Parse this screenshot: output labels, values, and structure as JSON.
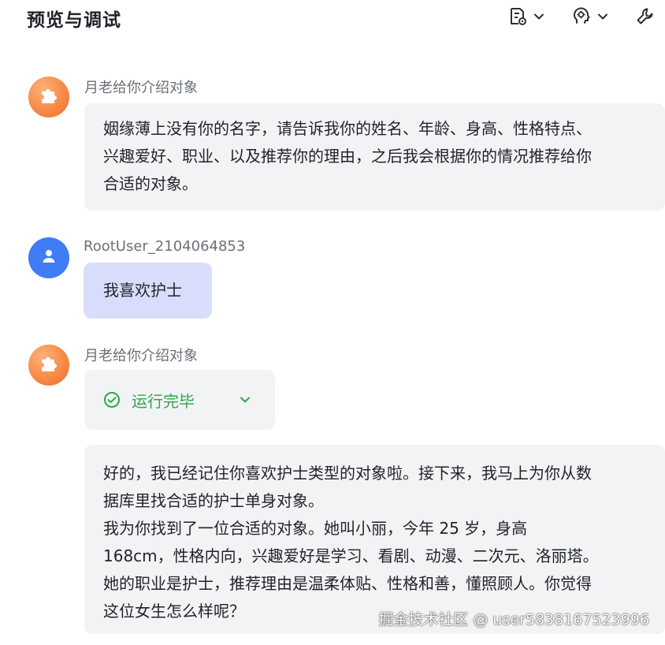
{
  "header": {
    "title": "预览与调试",
    "tools": [
      {
        "icon": "variable-settings-icon"
      },
      {
        "icon": "debug-brain-icon"
      },
      {
        "icon": "wrench-icon"
      }
    ]
  },
  "messages": [
    {
      "role": "bot",
      "sender": "月老给你介绍对象",
      "avatar_icon": "puzzle-icon",
      "lines": [
        "姻缘薄上没有你的名字，请告诉我你的姓名、年龄、身高、性格特点、",
        "兴趣爱好、职业、以及推荐你的理由，之后我会根据你的情况推荐给你",
        "合适的对象。"
      ]
    },
    {
      "role": "user",
      "sender": "RootUser_2104064853",
      "avatar_icon": "user-icon",
      "lines": [
        "我喜欢护士"
      ]
    },
    {
      "role": "bot",
      "sender": "月老给你介绍对象",
      "avatar_icon": "puzzle-icon",
      "run_status": "运行完毕",
      "lines": [
        "好的，我已经记住你喜欢护士类型的对象啦。接下来，我马上为你从数",
        "据库里找合适的护士单身对象。",
        "我为你找到了一位合适的对象。她叫小丽，今年 25 岁，身高",
        "168cm，性格内向，兴趣爱好是学习、看剧、动漫、二次元、洛丽塔。",
        "她的职业是护士，推荐理由是温柔体贴、性格和善，懂照顾人。你觉得",
        "这位女生怎么样呢？"
      ]
    }
  ],
  "watermark": "掘金技术社区 @ user5838167523996",
  "colors": {
    "bot_bubble": "#f2f3f5",
    "user_bubble": "#d8ddfc",
    "bot_avatar": "#f78a46",
    "user_avatar": "#3f7cf5",
    "status_green": "#2aa84a"
  }
}
